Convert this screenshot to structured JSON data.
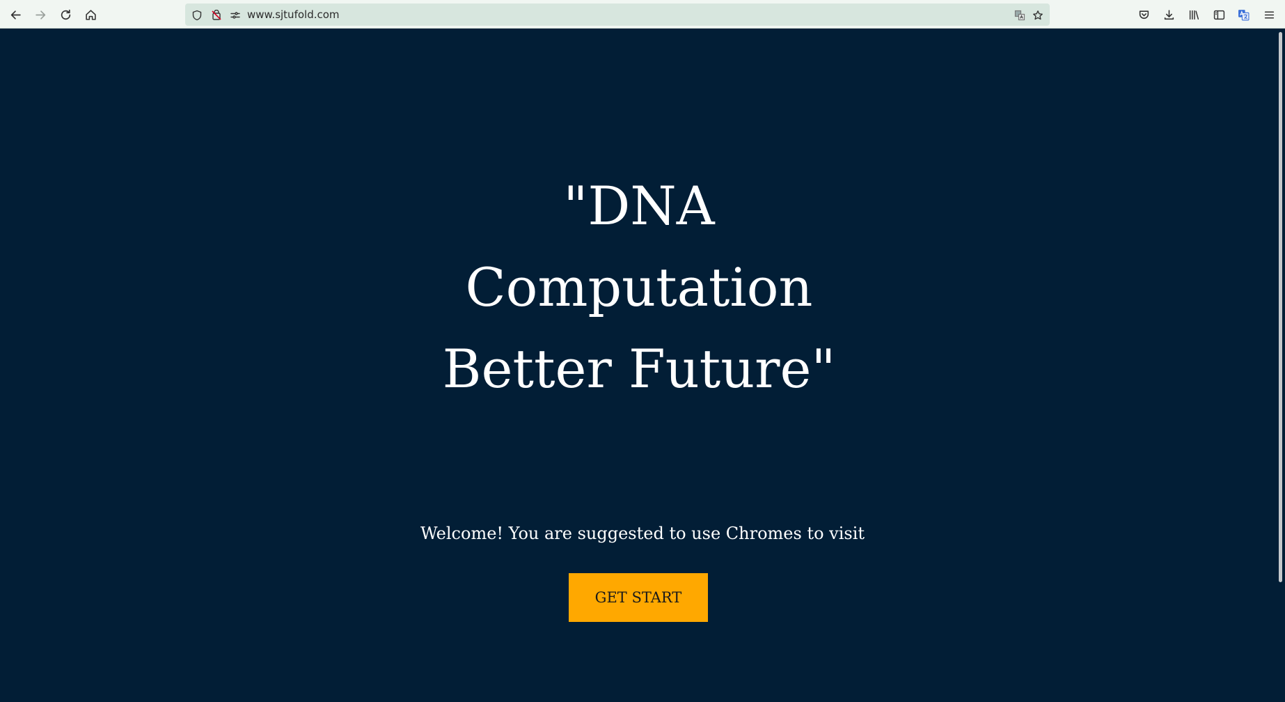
{
  "browser": {
    "url": "www.sjtufold.com"
  },
  "icons": {
    "back": "arrow-left-icon",
    "forward": "arrow-right-icon",
    "reload": "reload-icon",
    "home": "home-icon",
    "tracking_protection": "shield-icon",
    "permissions": "blocked-camera-icon",
    "site_info": "page-settings-icon",
    "translate": "translate-icon",
    "bookmark": "star-icon",
    "pocket": "pocket-icon",
    "downloads": "download-icon",
    "library": "library-icon",
    "sidebar": "sidebar-icon",
    "translate_ext": "translate-extension-icon",
    "menu": "hamburger-menu-icon"
  },
  "hero": {
    "line1": "\"DNA",
    "line2": "Computation",
    "line3": "Better Future\""
  },
  "welcome": {
    "text": "Welcome! You are suggested to use Chromes to visit"
  },
  "cta": {
    "label": "GET START"
  },
  "colors": {
    "page_background": "#021e36",
    "button_background": "#ffa800",
    "toolbar_background": "#f1f6f2",
    "urlbar_background": "#d7e6de"
  }
}
